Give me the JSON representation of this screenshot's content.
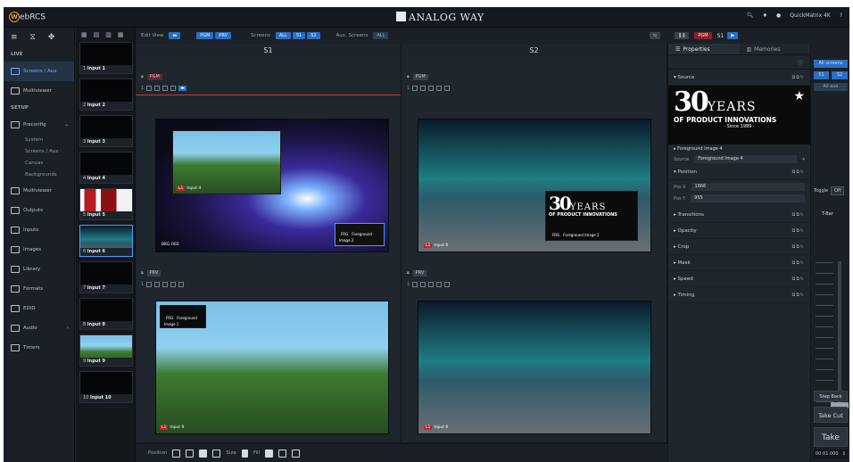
{
  "app": {
    "logo_letter": "W",
    "logo_text": "ebRCS",
    "brand": "ANALOG WAY",
    "user": "QuickMatrix 4K"
  },
  "nav": {
    "sections": [
      {
        "title": "LIVE",
        "items": [
          {
            "label": "Screens / Aux",
            "active": true
          },
          {
            "label": "Multiviewer"
          }
        ]
      },
      {
        "title": "SETUP",
        "items": [
          {
            "label": "Preconfig",
            "subitems": [
              "System",
              "Screens / Aux",
              "Canvas",
              "Backgrounds"
            ]
          },
          {
            "label": "Multiviewer"
          },
          {
            "label": "Outputs"
          },
          {
            "label": "Inputs"
          },
          {
            "label": "Images"
          },
          {
            "label": "Library"
          },
          {
            "label": "Formats"
          },
          {
            "label": "EDID"
          },
          {
            "label": "Audio"
          },
          {
            "label": "Timers"
          }
        ]
      }
    ]
  },
  "thumbs": [
    {
      "num": "1",
      "name": "Input 1",
      "style": "dark"
    },
    {
      "num": "2",
      "name": "Input 2",
      "style": "dark"
    },
    {
      "num": "3",
      "name": "Input 3",
      "style": "dark"
    },
    {
      "num": "4",
      "name": "Input 4",
      "style": "dark"
    },
    {
      "num": "5",
      "name": "Input 5",
      "style": "red"
    },
    {
      "num": "6",
      "name": "Input 6",
      "style": "aur",
      "selected": true
    },
    {
      "num": "7",
      "name": "Input 7",
      "style": "dark"
    },
    {
      "num": "8",
      "name": "Input 8",
      "style": "dark"
    },
    {
      "num": "9",
      "name": "Input 9",
      "style": "isl"
    },
    {
      "num": "10",
      "name": "Input 10",
      "style": "dark"
    }
  ],
  "toolbar": {
    "edit_view": "Edit View",
    "pgm_prv": "PGM",
    "prv": "PRV",
    "screens": "Screens",
    "all": "ALL",
    "s1": "S1",
    "s2": "S2",
    "aux": "Aux. Screens"
  },
  "screens": [
    {
      "title": "S1",
      "pgm": "PGM",
      "prv": "PRV",
      "layer_tag": "BKG",
      "tag1": "Input 4",
      "tag2": "PGM",
      "bkg": "BKG",
      "bkg_num": "002",
      "fg_label": "Foreground Image 2",
      "prv_tag": "Input 9",
      "fg_prv": "Foreground Image 1"
    },
    {
      "title": "S2",
      "pgm": "PGM",
      "prv": "PRV",
      "tag1": "Input 6",
      "fg_label": "Foreground Image 2",
      "prv_tag": "Input 6"
    }
  ],
  "props": {
    "tab1": "Properties",
    "tab2": "Memories",
    "header_label": "PGM",
    "header_screen": "S1",
    "source_title": "Source",
    "logo_big": "30",
    "logo_years": "YEARS",
    "logo_sub": "OF PRODUCT INNOVATIONS",
    "logo_since": "· Since 1989 ·",
    "fg_name": "Foreground Image 4",
    "src_label": "Source",
    "src_value": "Foreground Image 4",
    "position": "Position",
    "posx_label": "Pos X",
    "posx": "1666",
    "posy_label": "Pos Y",
    "posy": "955",
    "rows": [
      "Transitions",
      "Opacity",
      "Crop",
      "Mask",
      "Speed",
      "Timing"
    ]
  },
  "rail": {
    "all": "All screens",
    "s1": "S1",
    "s2": "S2",
    "all_aux": "All aux",
    "toggle": "Toggle",
    "toggle_val": "Off",
    "tbar": "T-Bar",
    "step": "Step Back",
    "takecut": "Take Cut",
    "take": "Take",
    "time": "00:01.000"
  },
  "bottom": {
    "position": "Position",
    "size": "Size",
    "fill": "Fill"
  }
}
